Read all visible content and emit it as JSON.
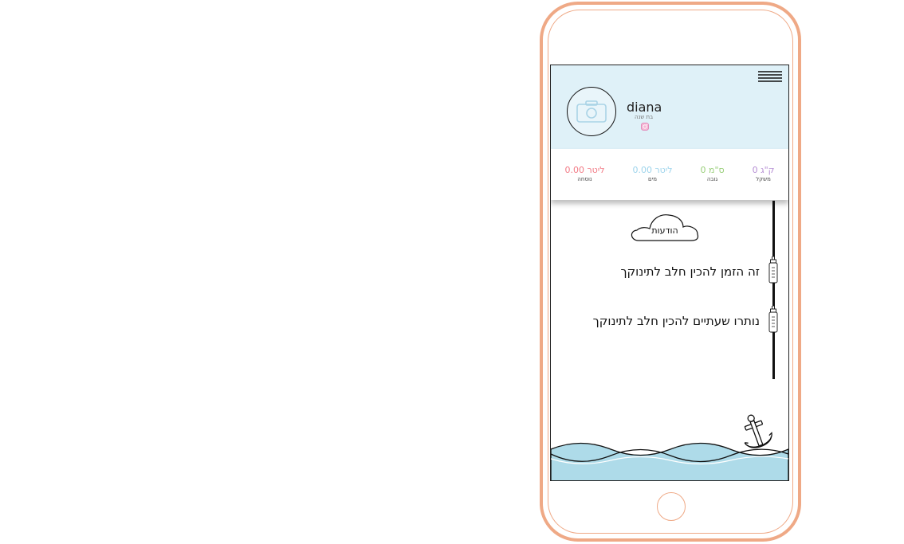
{
  "profile": {
    "name": "diana",
    "age": "בת שנה"
  },
  "stats": [
    {
      "value": "ק\"ג 0",
      "label": "משקל",
      "color": "#b68fd4"
    },
    {
      "value": "0 ס\"מ",
      "label": "גובה",
      "color": "#99cf7a"
    },
    {
      "value": "ליטר 0.00",
      "label": "מים",
      "color": "#9ed4ec"
    },
    {
      "value": "ליטר 0.00",
      "label": "נוסחה",
      "color": "#f27b86"
    }
  ],
  "notifications": {
    "title": "הודעות",
    "items": [
      {
        "text": "זה הזמן להכין חלב לתינוקך"
      },
      {
        "text": "נותרו שעתיים להכין חלב לתינוקך"
      }
    ]
  },
  "icons": {
    "menu": "hamburger-menu-icon",
    "camera": "camera-icon",
    "instagram": "instagram-icon",
    "bottle": "baby-bottle-icon",
    "anchor": "anchor-icon",
    "cloud": "cloud-icon"
  },
  "colors": {
    "phone_frame": "#efa986",
    "header_bg": "#dff1f8",
    "wave": "#aedbe9"
  }
}
